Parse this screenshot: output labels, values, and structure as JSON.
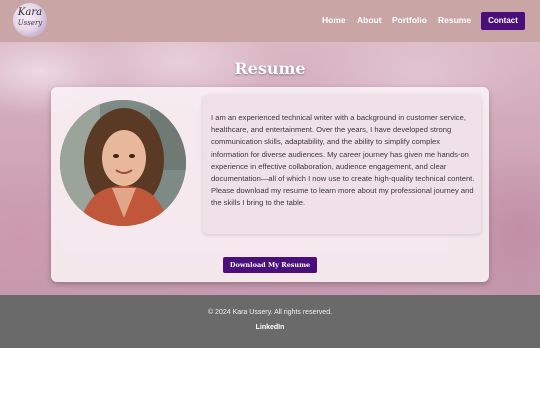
{
  "header": {
    "logo_text": "Kara",
    "logo_subtext": "Ussery",
    "nav": [
      "Home",
      "About",
      "Portfolio",
      "Resume"
    ],
    "contact_label": "Contact"
  },
  "main": {
    "title": "Resume",
    "bio": "I am an experienced technical writer with a background in customer service, healthcare, and entertainment. Over the years, I have developed strong communication skills, adaptability, and the ability to simplify complex information for diverse audiences. My career journey has given me hands-on experience in effective collaboration, audience engagement, and clear documentation—all of which I now use to create high-quality technical content. Please download my resume to learn more about my professional journey and the skills I bring to the table.",
    "download_label": "Download My Resume"
  },
  "footer": {
    "copyright": "© 2024 Kara Ussery. All rights reserved.",
    "linkedin_label": "LinkedIn"
  },
  "colors": {
    "accent": "#4a0f7a",
    "header_bg": "#c9a5a6",
    "footer_bg": "#6a6a6a"
  }
}
